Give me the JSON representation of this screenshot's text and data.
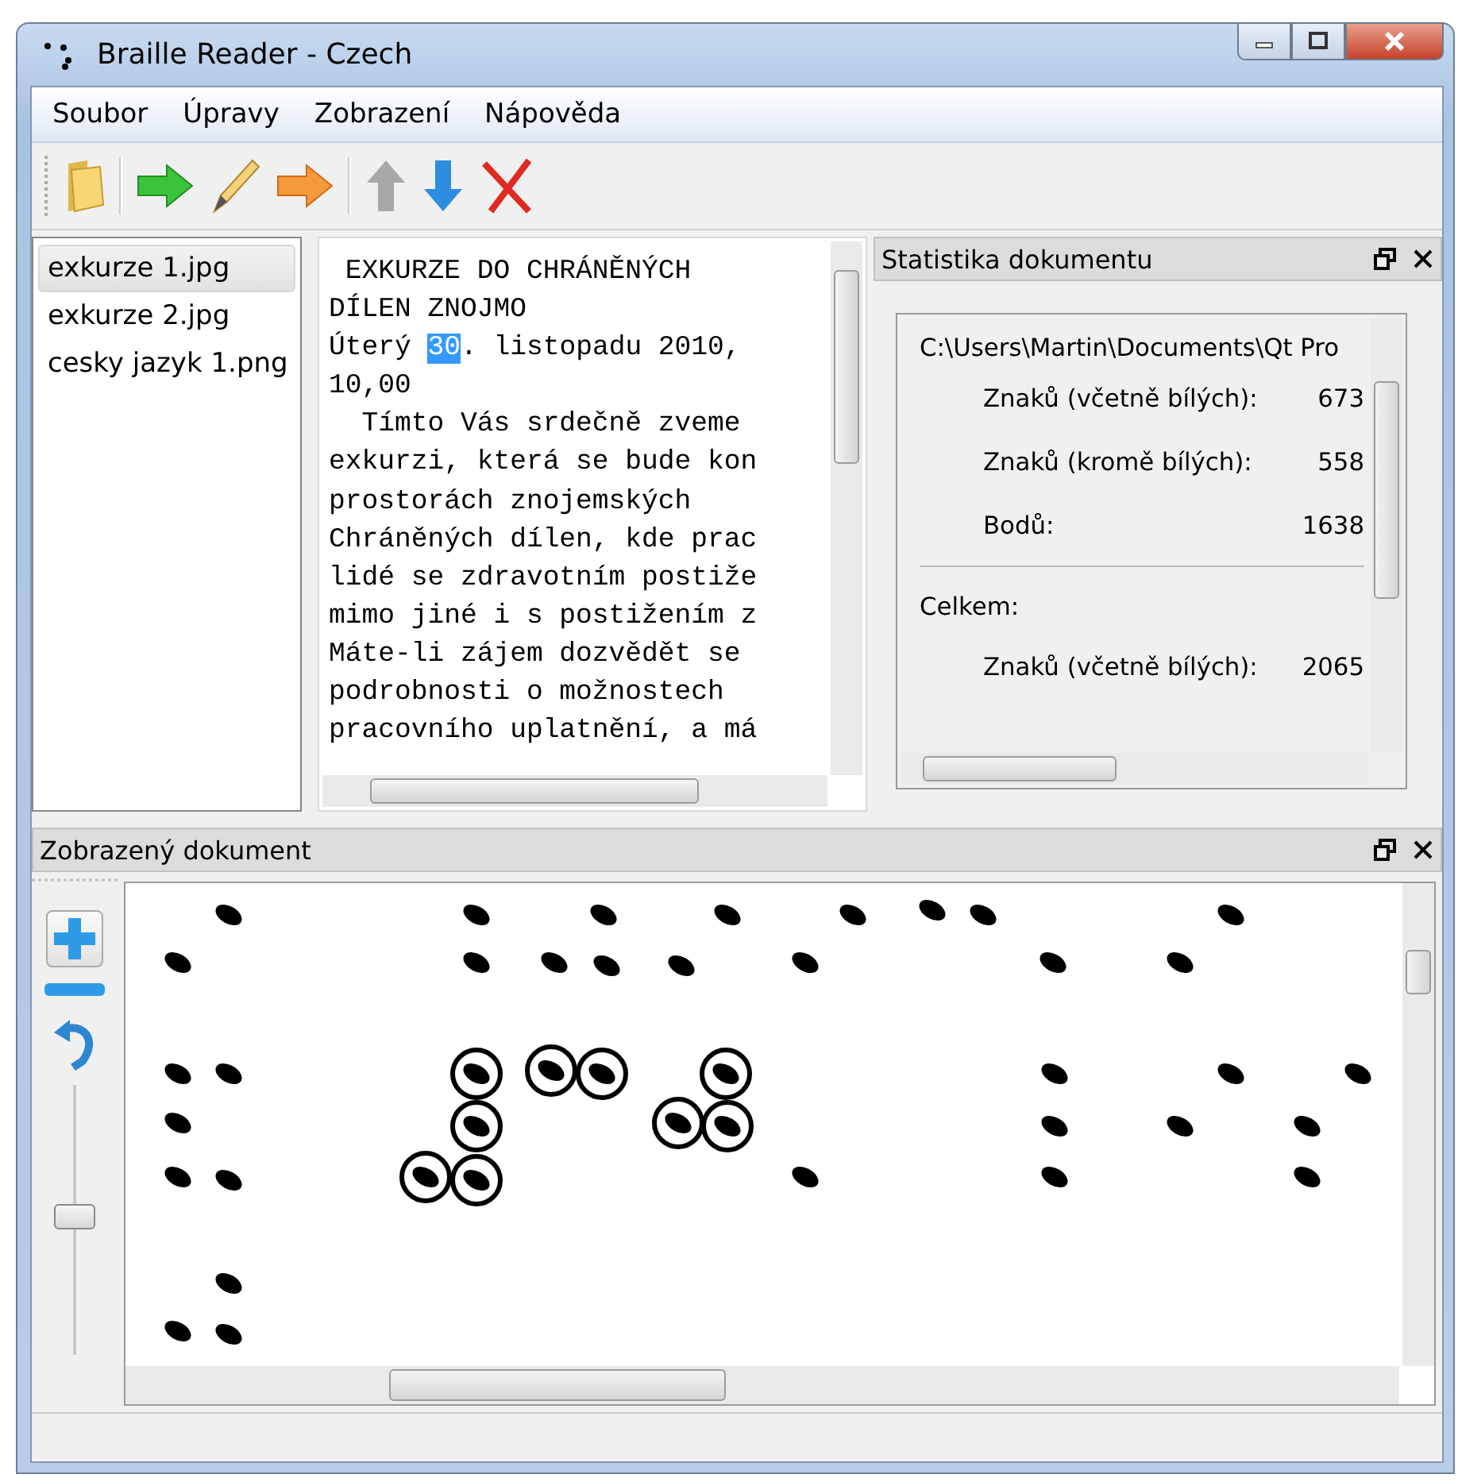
{
  "window": {
    "title": "Braille Reader - Czech"
  },
  "menu": [
    "Soubor",
    "Úpravy",
    "Zobrazení",
    "Nápověda"
  ],
  "files": [
    {
      "name": "exkurze 1.jpg",
      "selected": true
    },
    {
      "name": "exkurze 2.jpg",
      "selected": false
    },
    {
      "name": "cesky jazyk 1.png",
      "selected": false
    }
  ],
  "editor": {
    "lines": [
      [
        {
          "text": " EXKURZE DO CHRÁNĚNÝCH",
          "selected": false
        }
      ],
      [
        {
          "text": "DÍLEN ZNOJMO",
          "selected": false
        }
      ],
      [
        {
          "text": "Úterý ",
          "selected": false
        },
        {
          "text": "30",
          "selected": true
        },
        {
          "text": ". listopadu 2010,",
          "selected": false
        }
      ],
      [
        {
          "text": "10,00",
          "selected": false
        }
      ],
      [
        {
          "text": "  Tímto Vás srdečně zveme",
          "selected": false
        }
      ],
      [
        {
          "text": "exkurzi, která se bude kon",
          "selected": false
        }
      ],
      [
        {
          "text": "prostorách znojemských",
          "selected": false
        }
      ],
      [
        {
          "text": "Chráněných dílen, kde prac",
          "selected": false
        }
      ],
      [
        {
          "text": "lidé se zdravotním postiže",
          "selected": false
        }
      ],
      [
        {
          "text": "mimo jiné i s postižením z",
          "selected": false
        }
      ],
      [
        {
          "text": "Máte-li zájem dozvědět se",
          "selected": false
        }
      ],
      [
        {
          "text": "podrobnosti o možnostech",
          "selected": false
        }
      ],
      [
        {
          "text": "pracovního uplatnění, a má",
          "selected": false
        }
      ]
    ]
  },
  "stats_dock": {
    "title": "Statistika dokumentu",
    "path": "C:\\Users\\Martin\\Documents\\Qt Pro",
    "rows": [
      {
        "kind": "row",
        "label": "Znaků (včetně bílých):",
        "value": "673"
      },
      {
        "kind": "row",
        "label": "Znaků (kromě bílých):",
        "value": "558"
      },
      {
        "kind": "row",
        "label": "Bodů:",
        "value": "1638"
      },
      {
        "kind": "separator"
      },
      {
        "kind": "heading",
        "label": "Celkem:"
      },
      {
        "kind": "row",
        "label": "Znaků (včetně bílých):",
        "value": "2065"
      }
    ]
  },
  "document_dock": {
    "title": "Zobrazený dokument",
    "zoom_slider": {
      "level": 0.5
    }
  }
}
